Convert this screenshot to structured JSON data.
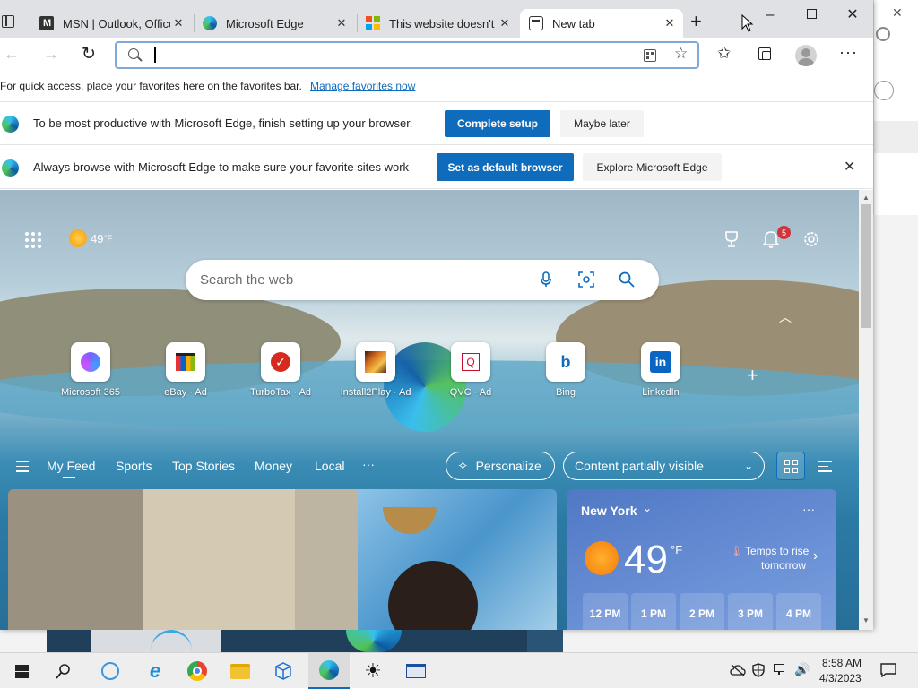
{
  "tabs": [
    {
      "title": "MSN | Outlook, Office"
    },
    {
      "title": "Microsoft Edge"
    },
    {
      "title": "This website doesn't w"
    },
    {
      "title": "New tab"
    }
  ],
  "address": {
    "value": ""
  },
  "favorites_bar": {
    "text": "For quick access, place your favorites here on the favorites bar.",
    "link": "Manage favorites now"
  },
  "setup_banner": {
    "text": "To be most productive with Microsoft Edge, finish setting up your browser.",
    "primary": "Complete setup",
    "secondary": "Maybe later"
  },
  "default_banner": {
    "text": "Always browse with Microsoft Edge to make sure your favorite sites work",
    "primary": "Set as default browser",
    "secondary": "Explore Microsoft Edge"
  },
  "ntp": {
    "weather_temp": "49",
    "weather_unit": "°F",
    "notification_count": "5",
    "search_placeholder": "Search the web",
    "quick_links": [
      {
        "label": "Microsoft 365"
      },
      {
        "label": "eBay · Ad"
      },
      {
        "label": "TurboTax · Ad"
      },
      {
        "label": "Install2Play · Ad"
      },
      {
        "label": "QVC · Ad"
      },
      {
        "label": "Bing"
      },
      {
        "label": "LinkedIn"
      }
    ],
    "feed_nav": [
      "My Feed",
      "Sports",
      "Top Stories",
      "Money",
      "Local"
    ],
    "more": "···",
    "personalize": "Personalize",
    "content_visibility": "Content partially visible"
  },
  "weather_card": {
    "city": "New York",
    "temp": "49",
    "unit": "°F",
    "note_line1": "Temps to rise",
    "note_line2": "tomorrow",
    "hours": [
      "12 PM",
      "1 PM",
      "2 PM",
      "3 PM",
      "4 PM"
    ]
  },
  "clock": {
    "time": "8:58 AM",
    "date": "4/3/2023"
  },
  "colors": {
    "accent": "#0f6cbd",
    "tab_strip": "#dfe1e4"
  }
}
